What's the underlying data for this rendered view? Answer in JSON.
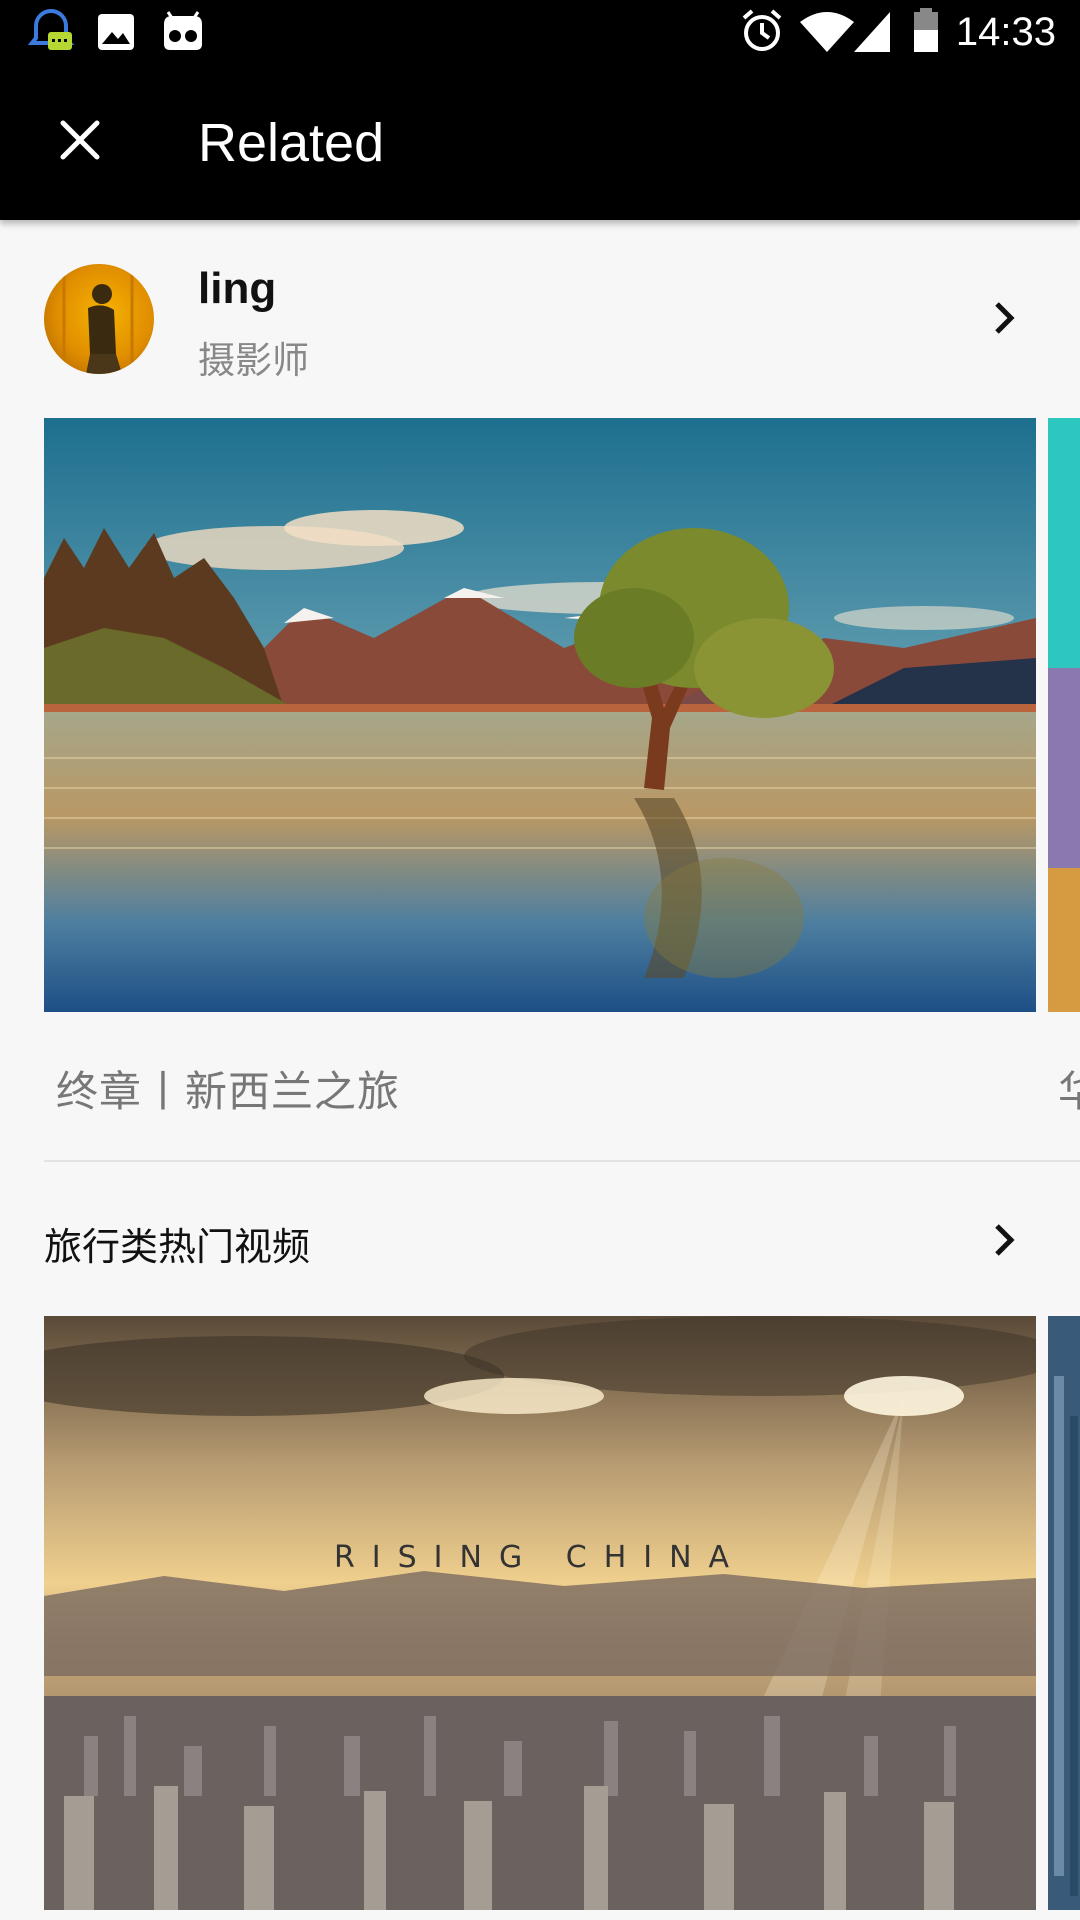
{
  "status_bar": {
    "time": "14:33",
    "icons": [
      "notification-bell-icon",
      "gallery-icon",
      "android-robot-icon",
      "alarm-icon",
      "wifi-icon",
      "signal-icon",
      "battery-icon"
    ]
  },
  "app_bar": {
    "title": "Related",
    "close_icon": "close-icon"
  },
  "author": {
    "name": "ling",
    "role": "摄影师"
  },
  "featured": {
    "items": [
      {
        "title": "终章丨新西兰之旅"
      },
      {
        "title": "华"
      }
    ]
  },
  "travel_section": {
    "title": "旅行类热门视频",
    "items": [
      {
        "overlay_text": "RISING CHINA"
      }
    ]
  },
  "colors": {
    "background": "#f7f7f7",
    "app_bar": "#000000",
    "text_primary": "#111111",
    "text_secondary": "#888888",
    "divider": "#e3e3e3"
  }
}
